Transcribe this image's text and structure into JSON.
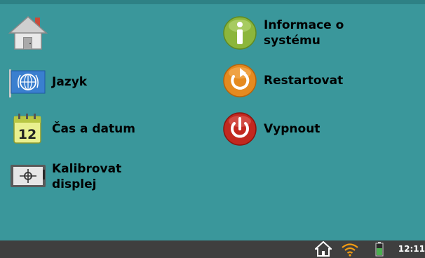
{
  "menu": {
    "home": {
      "label": "",
      "icon": "home-icon"
    },
    "language": {
      "label": "Jazyk",
      "icon": "globe-flag-icon"
    },
    "datetime": {
      "label": "Čas a datum",
      "icon": "calendar-icon",
      "calendar_day": "12"
    },
    "calibrate": {
      "label": "Kalibrovat\ndisplej",
      "icon": "calibration-target-icon"
    },
    "system_info": {
      "label": "Informace o\nsystému",
      "icon": "info-icon"
    },
    "restart": {
      "label": "Restartovat",
      "icon": "restart-icon"
    },
    "shutdown": {
      "label": "Vypnout",
      "icon": "power-icon"
    }
  },
  "taskbar": {
    "icons": [
      "home-icon",
      "wifi-icon",
      "battery-icon"
    ],
    "battery_level": 0.6,
    "clock": "12:11"
  },
  "colors": {
    "background": "#3a979b",
    "taskbar": "#3f3f3f",
    "info_green": "#8cb63c",
    "restart_orange": "#e58a1f",
    "power_red": "#c2281f",
    "wifi_orange": "#f39c12",
    "battery_green": "#4caf50"
  }
}
